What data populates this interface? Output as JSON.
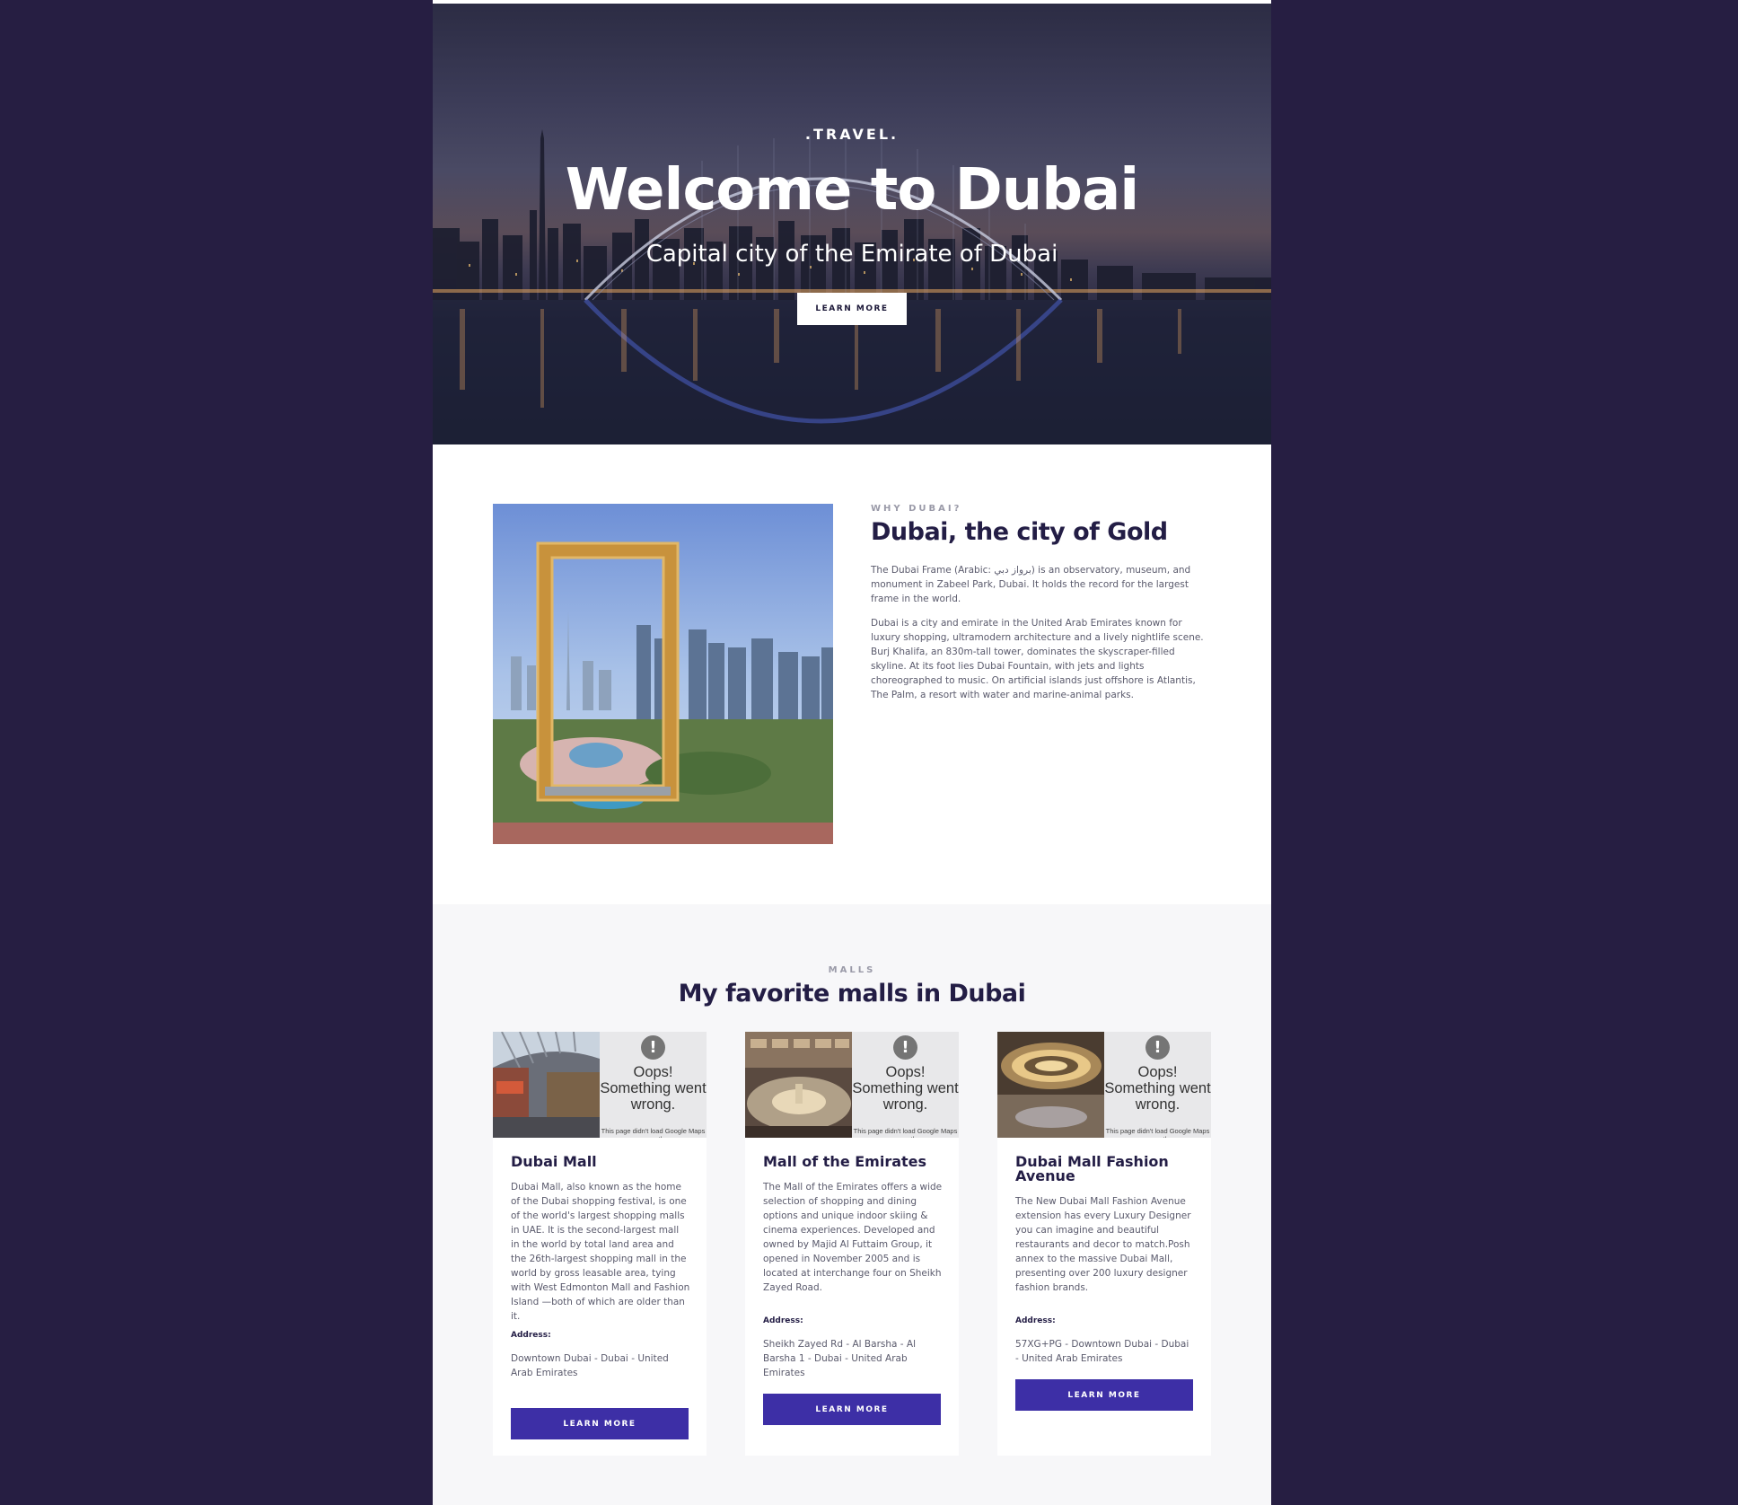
{
  "hero": {
    "eyebrow": ".TRAVEL.",
    "title": "Welcome to Dubai",
    "subtitle": "Capital city of the Emirate of Dubai",
    "button_label": "LEARN MORE"
  },
  "why": {
    "eyebrow": "WHY DUBAI?",
    "title": "Dubai, the city of Gold",
    "paragraph1": "The Dubai Frame (Arabic: برواز دبي) is an observatory, museum, and monument in Zabeel Park, Dubai. It holds the record for the largest frame in the world.",
    "paragraph2": "Dubai is a city and emirate in the United Arab Emirates known for luxury shopping, ultramodern architecture and a lively nightlife scene. Burj Khalifa, an 830m-tall tower, dominates the skyscraper-filled skyline. At its foot lies Dubai Fountain, with jets and lights choreographed to music. On artificial islands just offshore is Atlantis, The Palm, a resort with water and marine-animal parks."
  },
  "malls": {
    "eyebrow": "MALLS",
    "title": "My favorite malls in Dubai",
    "cards": [
      {
        "title": "Dubai Mall",
        "description": "Dubai Mall, also known as the home of the Dubai shopping festival, is one of the world's largest shopping malls in UAE. It is the second-largest mall in the world by total land area and the 26th-largest shopping mall in the world by gross leasable area, tying with West Edmonton Mall and Fashion Island —both of which are older than it.",
        "address_label": "Address:",
        "address": "Downtown Dubai - Dubai - United Arab Emirates",
        "map_error_title": "Oops! Something went wrong.",
        "map_error_detail": "This page didn't load Google Maps correctly.",
        "button_label": "LEARN MORE"
      },
      {
        "title": "Mall of the Emirates",
        "description": "The Mall of the Emirates offers a wide selection of shopping and dining options and unique indoor skiing & cinema experiences. Developed and owned by Majid Al Futtaim Group, it opened in November 2005 and is located at interchange four on Sheikh Zayed Road.",
        "address_label": "Address:",
        "address": "Sheikh Zayed Rd - Al Barsha - Al Barsha 1 - Dubai - United Arab Emirates",
        "map_error_title": "Oops! Something went wrong.",
        "map_error_detail": "This page didn't load Google Maps correctly.",
        "button_label": "LEARN MORE"
      },
      {
        "title": "Dubai Mall Fashion Avenue",
        "description": "The New Dubai Mall Fashion Avenue extension has every Luxury Designer you can imagine and beautiful restaurants and decor to match.Posh annex to the massive Dubai Mall, presenting over 200 luxury designer fashion brands.",
        "address_label": "Address:",
        "address": "57XG+PG - Downtown Dubai - Dubai - United Arab Emirates",
        "map_error_title": "Oops! Something went wrong.",
        "map_error_detail": "This page didn't load Google Maps correctly.",
        "button_label": "LEARN MORE"
      }
    ]
  }
}
